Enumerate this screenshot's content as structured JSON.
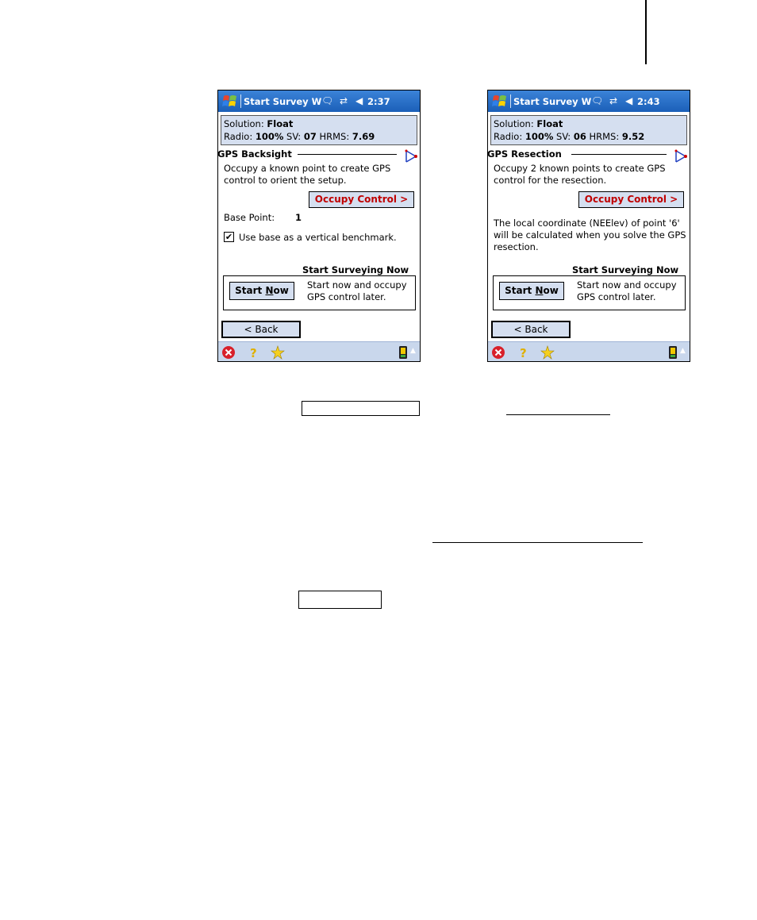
{
  "left_screen": {
    "title": "Start Survey W",
    "time": "2:37",
    "status": {
      "solution_label": "Solution:",
      "solution_value": "Float",
      "radio_label": "Radio:",
      "radio_value": "100%",
      "sv_label": "SV:",
      "sv_value": "07",
      "hrms_label": "HRMS:",
      "hrms_value": "7.69"
    },
    "group_title": "GPS Backsight",
    "description": "Occupy a known point to create GPS control to orient the setup.",
    "occupy_button": "Occupy Control >",
    "base_point_label": "Base Point:",
    "base_point_value": "1",
    "checkbox_checked": true,
    "checkbox_label": "Use base as a vertical benchmark.",
    "start_group_title": "Start Surveying Now",
    "start_button_pre": "Start ",
    "start_button_hot": "N",
    "start_button_post": "ow",
    "start_desc": "Start now and occupy GPS control later.",
    "back_button": "< Back"
  },
  "right_screen": {
    "title": "Start Survey W",
    "time": "2:43",
    "status": {
      "solution_label": "Solution:",
      "solution_value": "Float",
      "radio_label": "Radio:",
      "radio_value": "100%",
      "sv_label": "SV:",
      "sv_value": "06",
      "hrms_label": "HRMS:",
      "hrms_value": "9.52"
    },
    "group_title": "GPS Resection",
    "description": "Occupy 2 known points to create GPS control for the resection.",
    "occupy_button": "Occupy Control >",
    "note": "The local coordinate (NEElev) of point '6' will be calculated when you solve the GPS resection.",
    "start_group_title": "Start Surveying Now",
    "start_button_pre": "Start ",
    "start_button_hot": "N",
    "start_button_post": "ow",
    "start_desc": "Start now and occupy GPS control later.",
    "back_button": "< Back"
  },
  "icons": {
    "title_bar": [
      "windows-start-icon",
      "messaging-icon",
      "connectivity-icon",
      "volume-icon"
    ],
    "bottom_bar": [
      "close-icon",
      "help-icon",
      "favorites-icon",
      "device-icon",
      "scroll-up-icon"
    ],
    "snap_icon": "resection-snap-icon"
  },
  "colors": {
    "title_bar": "#1b5fb8",
    "panel_fill": "#d5dff0",
    "accent_red": "#c00000",
    "bottom_bar": "#c9d7ec"
  }
}
